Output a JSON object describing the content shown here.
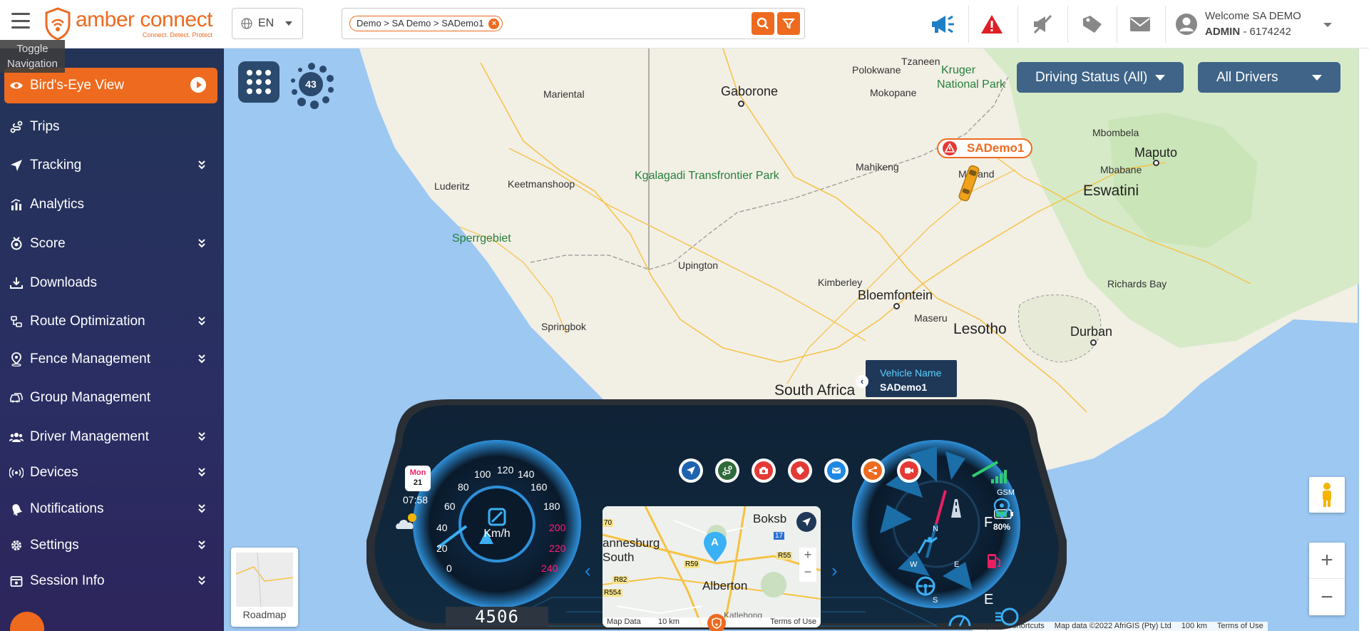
{
  "header": {
    "toggle_tooltip": "Toggle Navigation",
    "logo": {
      "name": "amber connect",
      "tagline": "Connect. Detect. Protect"
    },
    "language": "EN",
    "breadcrumb_chip": "Demo > SA Demo > SADemo1",
    "user": {
      "welcome": "Welcome SA DEMO",
      "role": "ADMIN",
      "account": "- 6174242"
    },
    "icons": [
      "megaphone-icon",
      "alert-triangle-icon",
      "muted-megaphone-icon",
      "tag-icon",
      "mail-icon",
      "user-avatar-icon"
    ]
  },
  "sidebar": {
    "items": [
      {
        "label": "Bird's-Eye View",
        "icon": "eye-icon",
        "active": true
      },
      {
        "label": "Trips",
        "icon": "route-icon"
      },
      {
        "label": "Tracking",
        "icon": "location-arrow-icon",
        "expandable": true
      },
      {
        "label": "Analytics",
        "icon": "bar-chart-icon"
      },
      {
        "label": "Score",
        "icon": "medal-icon",
        "expandable": true
      },
      {
        "label": "Downloads",
        "icon": "download-icon"
      },
      {
        "label": "Route Optimization",
        "icon": "route-optimize-icon",
        "expandable": true
      },
      {
        "label": "Fence Management",
        "icon": "fence-pin-icon",
        "expandable": true
      },
      {
        "label": "Group Management",
        "icon": "car-group-icon"
      },
      {
        "label": "Driver Management",
        "icon": "users-icon",
        "expandable": true
      },
      {
        "label": "Devices",
        "icon": "device-signal-icon",
        "expandable": true
      },
      {
        "label": "Notifications",
        "icon": "bell-icon",
        "expandable": true
      },
      {
        "label": "Settings",
        "icon": "gear-icon",
        "expandable": true
      },
      {
        "label": "Session Info",
        "icon": "session-icon",
        "expandable": true
      }
    ]
  },
  "map": {
    "cluster_count": "43",
    "driving_status": "Driving Status (All)",
    "drivers": "All Drivers",
    "vehicle_label": "SADemo1",
    "vehicle_info": {
      "label": "Vehicle Name",
      "value": "SADemo1"
    },
    "places": {
      "gaborone": "Gaborone",
      "polokwane": "Polokwane",
      "tzaneen": "Tzaneen",
      "kruger": "Kruger",
      "national_park": "National Park",
      "mokopane": "Mokopane",
      "mbombela": "Mbombela",
      "maputo": "Maputo",
      "mbabane": "Mbabane",
      "eswatini": "Eswatini",
      "mariental": "Mariental",
      "kgalagadi": "Kgalagadi Transfrontier Park",
      "keetmanshoop": "Keetmanshoop",
      "luderitz": "Luderitz",
      "mahikeng": "Mahikeng",
      "midrand": "Midrand",
      "sperrgebiet": "Sperrgebiet",
      "upington": "Upington",
      "kimberley": "Kimberley",
      "bloemfontein": "Bloemfontein",
      "richards_bay": "Richards Bay",
      "springbok": "Springbok",
      "maseru": "Maseru",
      "lesotho": "Lesotho",
      "durban": "Durban",
      "south_africa": "South Africa"
    },
    "roadmap_label": "Roadmap",
    "attribution": [
      "Keyboard shortcuts",
      "Map data ©2022 AfriGIS (Pty) Ltd",
      "100 km",
      "Terms of Use"
    ],
    "zoom_in": "+",
    "zoom_out": "−"
  },
  "dashboard": {
    "day": "Mon",
    "date": "21",
    "time": "07:58",
    "speed_unit": "Km/h",
    "odometer": "4506",
    "speed_ticks": [
      "0",
      "20",
      "40",
      "60",
      "80",
      "100",
      "120",
      "140",
      "160",
      "180",
      "200",
      "220",
      "240"
    ],
    "gsm_label": "GSM",
    "battery": "80%",
    "compass": [
      "N",
      "E",
      "S",
      "W"
    ],
    "fuel": [
      "F",
      "E"
    ],
    "toolbar_icons": [
      "navigate-icon",
      "route-icon",
      "camera-icon",
      "pin-icon",
      "mail-icon",
      "share-icon",
      "video-icon"
    ],
    "minimap": {
      "places": {
        "boksb": "Boksb",
        "annesburg": "annesburg",
        "south": "South",
        "alberton": "Alberton",
        "katlehong": "Katlehong"
      },
      "roads": [
        "R59",
        "R55",
        "R82",
        "R554",
        "17",
        "70"
      ],
      "footer": [
        "Map Data",
        "10 km",
        "Terms of Use"
      ],
      "marker": "A"
    }
  }
}
